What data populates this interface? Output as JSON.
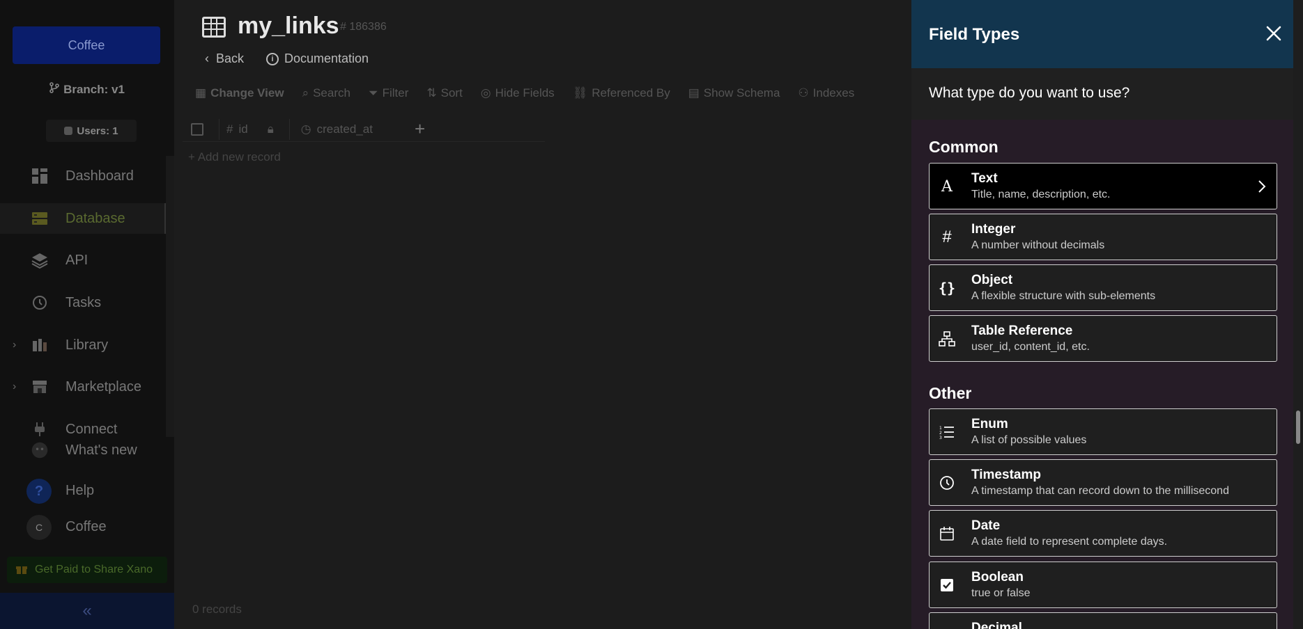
{
  "sidebar": {
    "workspace_label": "Coffee",
    "branch_label": "Branch: v1",
    "users_label": "Users: 1",
    "nav": [
      {
        "label": "Dashboard",
        "icon": "dashboard-icon"
      },
      {
        "label": "Database",
        "icon": "database-icon"
      },
      {
        "label": "API",
        "icon": "api-layers-icon"
      },
      {
        "label": "Tasks",
        "icon": "tasks-clock-icon"
      },
      {
        "label": "Library",
        "icon": "library-icon"
      },
      {
        "label": "Marketplace",
        "icon": "marketplace-store-icon"
      },
      {
        "label": "Connect",
        "icon": "connect-plug-icon"
      },
      {
        "label": "What's new",
        "icon": "whats-new-icon"
      }
    ],
    "help_label": "Help",
    "user_initial": "C",
    "user_label": "Coffee",
    "promo_label": "Get Paid to Share Xano",
    "collapse_glyph": "«"
  },
  "main": {
    "title": "my_links",
    "table_id": "# 186386",
    "back_label": "Back",
    "docs_label": "Documentation",
    "toolbar": [
      "Change View",
      "Search",
      "Filter",
      "Sort",
      "Hide Fields",
      "Referenced By",
      "Show Schema",
      "Indexes"
    ],
    "columns": [
      "id",
      "created_at"
    ],
    "add_record_label": "+ Add new record",
    "records_label": "0 records"
  },
  "drawer": {
    "title": "Field Types",
    "question": "What type do you want to use?",
    "common_title": "Common",
    "common": [
      {
        "name": "Text",
        "desc": "Title, name, description, etc.",
        "icon": "text-a-icon"
      },
      {
        "name": "Integer",
        "desc": "A number without decimals",
        "icon": "hash-icon"
      },
      {
        "name": "Object",
        "desc": "A flexible structure with sub-elements",
        "icon": "braces-icon"
      },
      {
        "name": "Table Reference",
        "desc": "user_id, content_id, etc.",
        "icon": "hierarchy-icon"
      }
    ],
    "other_title": "Other",
    "other": [
      {
        "name": "Enum",
        "desc": "A list of possible values",
        "icon": "list-icon"
      },
      {
        "name": "Timestamp",
        "desc": "A timestamp that can record down to the millisecond",
        "icon": "clock-icon"
      },
      {
        "name": "Date",
        "desc": "A date field to represent complete days.",
        "icon": "calendar-icon"
      },
      {
        "name": "Boolean",
        "desc": "true or false",
        "icon": "checkbox-icon"
      },
      {
        "name": "Decimal",
        "desc": "",
        "icon": "decimal-icon"
      }
    ]
  },
  "colors": {
    "drawer_header": "#12354e",
    "drawer_body": "#261c27",
    "highlight_item": "#000000"
  }
}
